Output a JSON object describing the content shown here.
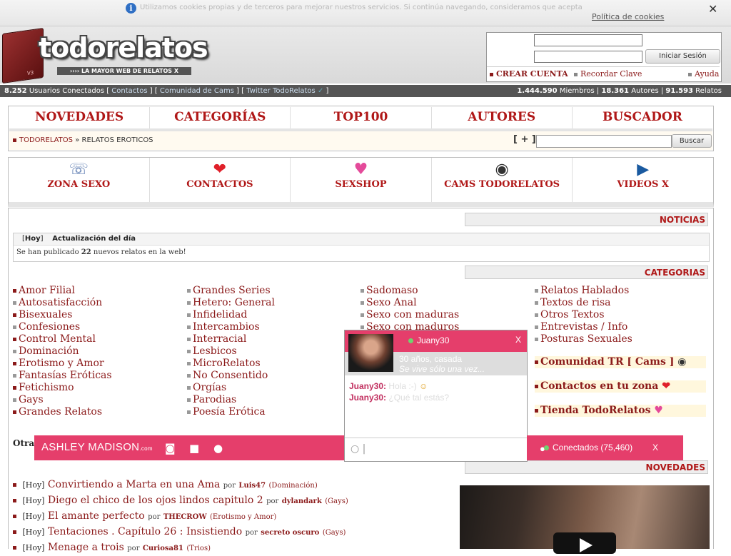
{
  "cookie": {
    "text": "Utilizamos cookies propias y de terceros para mejorar nuestros servicios. Si continúa navegando, consideramos que acepta su uso.",
    "policy_link": "Política de cookies",
    "close": "✕"
  },
  "header": {
    "logo": "todorelatos",
    "book_label": "V3",
    "tagline": "›››› LA MAYOR WEB DE RELATOS X",
    "login_button": "Iniciar Sesión",
    "create_account": "CREAR CUENTA",
    "remember": "Recordar Clave",
    "help": "Ayuda"
  },
  "statusbar": {
    "users_count": "8.252",
    "users_label": " Usuarios Conectados [ ",
    "link_contacts": "Contactos",
    "sep1": " ] [ ",
    "link_cams": "Comunidad de Cams",
    "sep2": " ] [ ",
    "link_twitter": "Twitter TodoRelatos",
    "end": " ]",
    "members": "1.444.590",
    "members_label": " Miembros | ",
    "authors": "18.361",
    "authors_label": " Autores | ",
    "stories": "91.593",
    "stories_label": " Relatos"
  },
  "nav": {
    "items": [
      "NOVEDADES",
      "CATEGORÍAS",
      "TOP100",
      "AUTORES",
      "BUSCADOR"
    ],
    "crumb_home": "TODORELATOS",
    "crumb_sep": " » ",
    "crumb_current": "RELATOS EROTICOS",
    "plus": "[ + ]",
    "search_button": "Buscar"
  },
  "iconbar": {
    "items": [
      {
        "label": "ZONA SEXO",
        "icon": "headset-icon",
        "glyph": "☏"
      },
      {
        "label": "CONTACTOS",
        "icon": "heart-icon",
        "glyph": "❤"
      },
      {
        "label": "SEXSHOP",
        "icon": "lingerie-icon",
        "glyph": "♥"
      },
      {
        "label": "CAMS TODORELATOS",
        "icon": "webcam-icon",
        "glyph": "◉"
      },
      {
        "label": "VIDEOS X",
        "icon": "film-icon",
        "glyph": "▶"
      }
    ]
  },
  "sections": {
    "noticias": "NOTICIAS",
    "categorias": "CATEGORIAS",
    "novedades": "NOVEDADES"
  },
  "news": {
    "tag": "Hoy",
    "title": "Actualización del día",
    "body_pre": "Se han publicado ",
    "body_num": "22",
    "body_post": " nuevos relatos en la web!"
  },
  "categories": {
    "col1": [
      "Amor Filial",
      "Autosatisfacción",
      "Bisexuales",
      "Confesiones",
      "Control Mental",
      "Dominación",
      "Erotismo y Amor",
      "Fantasías Eróticas",
      "Fetichismo",
      "Gays",
      "Grandes Relatos"
    ],
    "col2": [
      "Grandes Series",
      "Hetero: General",
      "Infidelidad",
      "Intercambios",
      "Interracial",
      "Lesbicos",
      "MicroRelatos",
      "No Consentido",
      "Orgías",
      "Parodias",
      "Poesía Erótica"
    ],
    "col3": [
      "Sadomaso",
      "Sexo Anal",
      "Sexo con maduras",
      "Sexo con maduros"
    ],
    "col4": [
      "Relatos Hablados",
      "Textos de risa",
      "Otros Textos",
      "Entrevistas / Info",
      "Posturas Sexuales"
    ],
    "special": [
      "Comunidad TR [ Cams ]",
      "Contactos en tu zona",
      "Tienda TodoRelatos"
    ],
    "otras": "Otras"
  },
  "ashley": {
    "brand": "ASHLEY MADISON",
    "suffix": ".com"
  },
  "chat": {
    "name": "Juany30",
    "close": "X",
    "profile_line1": "30 años, casada",
    "profile_line2": "Se vive sólo una vez...",
    "messages": [
      {
        "who": "Juany30:",
        "text": "Hola :-)"
      },
      {
        "who": "Juany30:",
        "text": "¿Qué tal estás?"
      }
    ],
    "input_cursor": "|"
  },
  "connected": {
    "label": "Conectados (75,460)",
    "close": "X"
  },
  "novedades": [
    {
      "tag": "[Hoy]",
      "title": "Convirtiendo a Marta en una Ama",
      "por": "por",
      "author": "Luis47",
      "cat": "(Dominación)"
    },
    {
      "tag": "[Hoy]",
      "title": "Diego el chico de los ojos lindos capitulo 2",
      "por": "por",
      "author": "dylandark",
      "cat": "(Gays)"
    },
    {
      "tag": "[Hoy]",
      "title": "El amante perfecto",
      "por": "por",
      "author": "THECROW",
      "cat": "(Erotismo y Amor)"
    },
    {
      "tag": "[Hoy]",
      "title": "Tentaciones . Capítulo 26 : Insistiendo",
      "por": "por",
      "author": "secreto oscuro",
      "cat": "(Gays)"
    },
    {
      "tag": "[Hoy]",
      "title": "Menage a trois",
      "por": "por",
      "author": "Curiosa81",
      "cat": "(Trios)"
    }
  ]
}
